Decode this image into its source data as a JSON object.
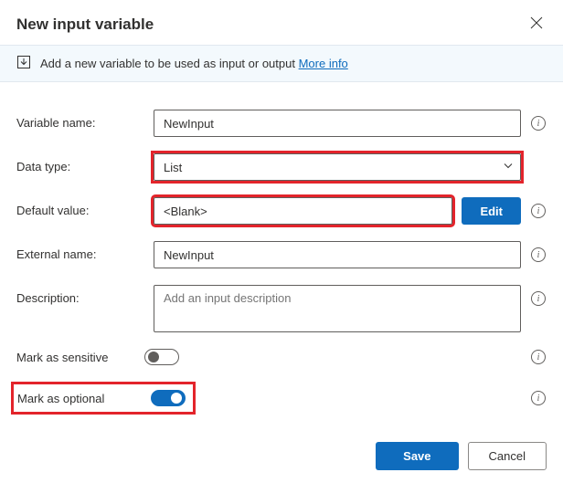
{
  "dialog": {
    "title": "New input variable",
    "banner_text": "Add a new variable to be used as input or output",
    "banner_link": "More info"
  },
  "fields": {
    "variable_name": {
      "label": "Variable name:",
      "value": "NewInput"
    },
    "data_type": {
      "label": "Data type:",
      "value": "List"
    },
    "default_value": {
      "label": "Default value:",
      "value": "<Blank>",
      "edit_label": "Edit"
    },
    "external_name": {
      "label": "External name:",
      "value": "NewInput"
    },
    "description": {
      "label": "Description:",
      "placeholder": "Add an input description"
    },
    "mark_sensitive": {
      "label": "Mark as sensitive",
      "on": false
    },
    "mark_optional": {
      "label": "Mark as optional",
      "on": true
    }
  },
  "footer": {
    "save": "Save",
    "cancel": "Cancel"
  },
  "highlights": [
    "data_type",
    "default_value",
    "mark_optional"
  ]
}
